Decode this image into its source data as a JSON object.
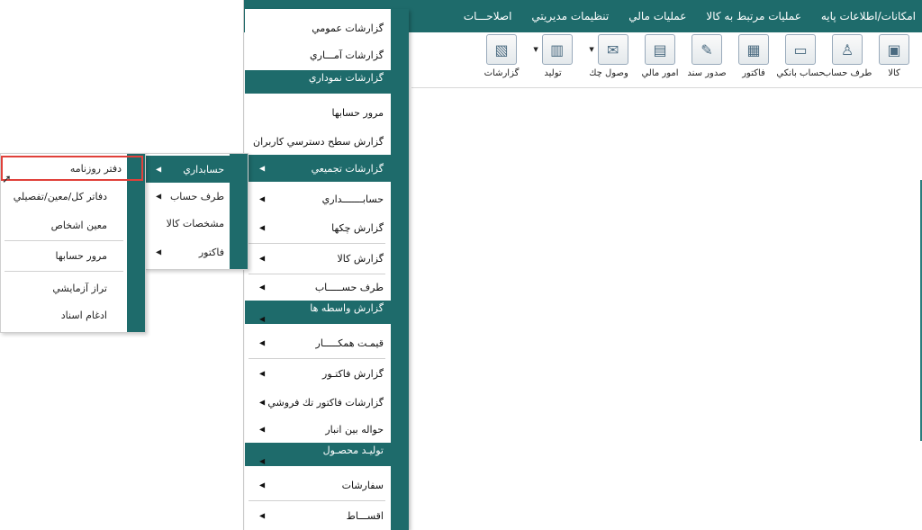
{
  "menubar": {
    "items": [
      "امکانات/اطلاعات پایه",
      "عملیات مرتبط به کالا",
      "عملیات مالي",
      "تنظیمات مدیریتي",
      "اصلاحـــات"
    ]
  },
  "toolbar": {
    "buttons": [
      {
        "label": "کالا",
        "icon": "box-icon"
      },
      {
        "label": "طرف حساب",
        "icon": "person-icon"
      },
      {
        "label": "حساب بانکي",
        "icon": "bank-card-icon"
      },
      {
        "label": "فاکتور",
        "icon": "invoice-icon"
      },
      {
        "label": "صدور سند",
        "icon": "document-edit-icon"
      },
      {
        "label": "امور مالي",
        "icon": "calculator-icon"
      },
      {
        "label": "وصول چك",
        "icon": "check-icon"
      },
      {
        "label": "تولید",
        "icon": "factory-icon"
      },
      {
        "label": "گزارشات",
        "icon": "report-chart-icon"
      }
    ]
  },
  "menu": {
    "general_reports": "گزارشات عمومي",
    "statistical_reports": "گزارشات آمـــاري",
    "section_chart_reports": "گزارشات نموداري",
    "accounts_review": "مرور حسابها",
    "user_access_report": "گزارش سطح دسترسي کاربران",
    "cumulative_reports": "گزارشات تجمیعي",
    "accounting": "حسابـــــــداري",
    "cheques_report": "گزارش چکها",
    "goods_report": "گزارش کالا",
    "party": "طرف حســـــاب",
    "section_broker_reports": "گزارش واسطه ها",
    "partner_price": "قیمـت همکـــــار",
    "invoice_report": "گزارش فاکتـور",
    "single_invoice_reports": "گزارشات فاکتور تك فروشي",
    "warehouse_transfer": "حواله بین انبار",
    "section_production": "تولیـد محصـول",
    "orders": "سفارشات",
    "installments": "اقســـاط"
  },
  "submenu1": {
    "accounting": "حسابداري",
    "party": "طرف حساب",
    "goods_specs": "مشخصات کالا",
    "invoice": "فاکتور"
  },
  "submenu2": {
    "journal": "دفتر روزنامه",
    "ledgers": "دفاتر کل/معین/تفصیلي",
    "person_detail": "معین اشخاص",
    "accounts_review": "مرور حسابها",
    "trial_balance": "تراز آزمایشي",
    "merge_documents": "ادغام اسناد"
  },
  "colors": {
    "accent": "#1e6b6b",
    "selection_border": "#e0403a"
  }
}
